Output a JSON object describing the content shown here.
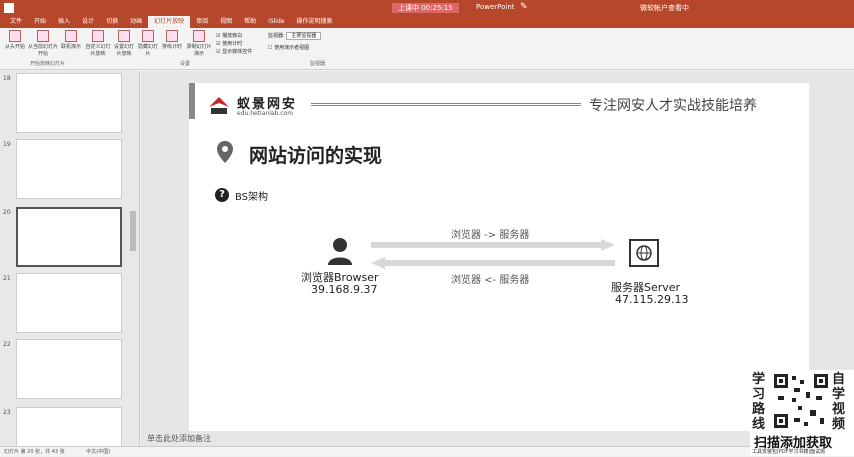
{
  "window": {
    "title": "上课中 00:25:15",
    "app": "PowerPoint",
    "hidden_title": "微软帐户查看中"
  },
  "tabs": [
    "文件",
    "开始",
    "插入",
    "设计",
    "切换",
    "动画",
    "幻灯片放映",
    "审阅",
    "视图",
    "帮助",
    "iSlide",
    "操作说明搜索"
  ],
  "ribbon": {
    "buttons": [
      "从头开始",
      "从当前幻灯片开始",
      "联机演示",
      "自定义幻灯片放映",
      "设置幻灯片放映",
      "隐藏幻灯片",
      "排练计时",
      "录制幻灯片演示"
    ],
    "checks": [
      "播放旁白",
      "使用计时",
      "显示媒体控件"
    ],
    "monitor_label": "监视器",
    "monitor_value": "主要监视器",
    "presenter_view": "使用演示者视图",
    "groups": [
      "开始放映幻灯片",
      "设置",
      "监视器"
    ]
  },
  "thumbnails": [
    {
      "num": "18"
    },
    {
      "num": "19"
    },
    {
      "num": "20"
    },
    {
      "num": "21"
    },
    {
      "num": "22"
    },
    {
      "num": "23"
    }
  ],
  "slide": {
    "logo_name": "蚁景网安",
    "logo_url": "edu.hetianlab.com",
    "slogan": "专注网安人才实战技能培养",
    "title": "网站访问的实现",
    "subtitle": "BS架构",
    "browser_label": "浏览器Browser",
    "browser_ip": "39.168.9.37",
    "server_label": "服务器Server",
    "server_ip": "47.115.29.13",
    "arrow_top": "浏览器 -> 服务器",
    "arrow_bottom": "浏览器 <- 服务器"
  },
  "notes": "单击此处添加备注",
  "status": {
    "slide_info": "幻灯片 第 20 张，共 43 张",
    "lang": "中文(中国)"
  },
  "promo": {
    "left": [
      "学",
      "习",
      "路",
      "线"
    ],
    "right": [
      "自",
      "学",
      "视",
      "频"
    ],
    "cta": "扫描添加获取",
    "sub": "工具安装包|PDF学习书籍|面试题"
  },
  "colors": {
    "brand": "#b7472a",
    "slide_text": "#222222",
    "arrow": "#d8d8d8"
  }
}
